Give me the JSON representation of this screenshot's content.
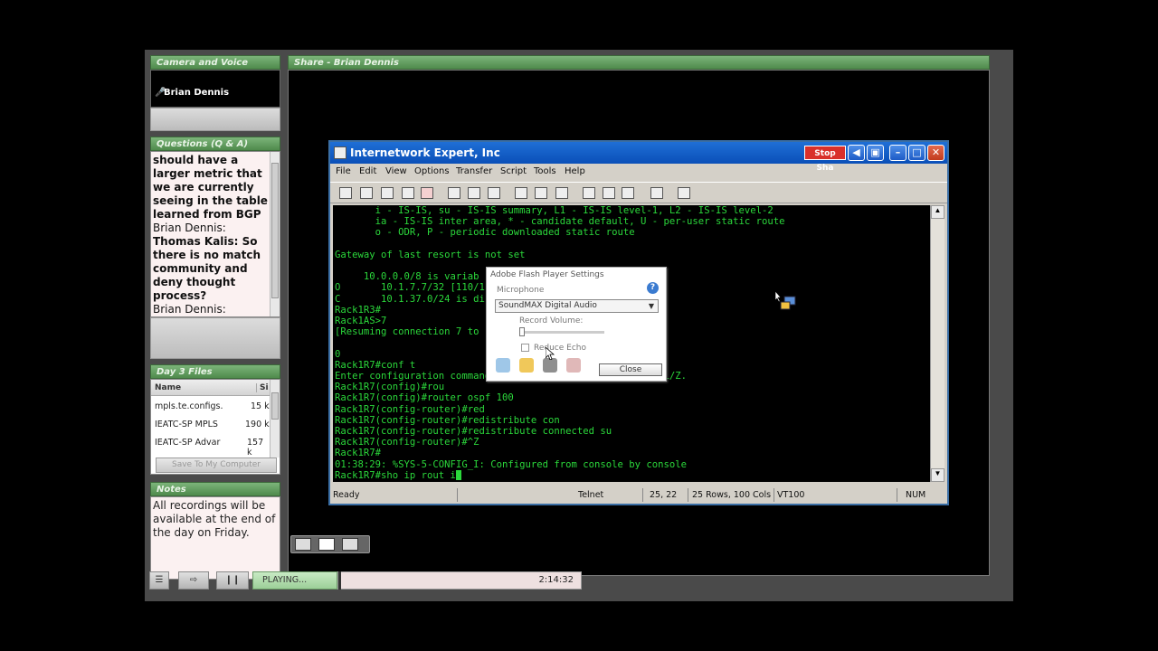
{
  "panels": {
    "camera": {
      "title": "Camera and Voice",
      "presenter": "Brian Dennis"
    },
    "qa": {
      "title": "Questions (Q & A)",
      "lines": [
        {
          "text": "should have a",
          "bold": true
        },
        {
          "text": "larger metric that",
          "bold": true
        },
        {
          "text": "we are currently",
          "bold": true
        },
        {
          "text": "seeing in the table",
          "bold": true
        },
        {
          "text": "learned from BGP",
          "bold": true
        },
        {
          "text": "Brian Dennis:",
          "bold": false
        },
        {
          "text": "Thomas Kalis: So",
          "bold": true
        },
        {
          "text": "there is no match",
          "bold": true
        },
        {
          "text": "community and",
          "bold": true
        },
        {
          "text": "deny thought",
          "bold": true
        },
        {
          "text": "process?",
          "bold": true
        },
        {
          "text": "Brian Dennis:",
          "bold": false
        }
      ]
    },
    "files": {
      "title": "Day 3 Files",
      "col_name": "Name",
      "col_size": "Si",
      "rows": [
        {
          "name": "mpls.te.configs.",
          "size": "15 k"
        },
        {
          "name": "IEATC-SP MPLS",
          "size": "190 k"
        },
        {
          "name": "IEATC-SP Advar",
          "size": "157 k"
        }
      ],
      "save_label": "Save To My Computer"
    },
    "notes": {
      "title": "Notes",
      "text": "All recordings will be available at the end of the day on Friday."
    },
    "share": {
      "title": "Share - Brian Dennis"
    }
  },
  "window": {
    "title": "Internetwork Expert, Inc",
    "stop_share": "Stop Sha",
    "menu": [
      "File",
      "Edit",
      "View",
      "Options",
      "Transfer",
      "Script",
      "Tools",
      "Help"
    ],
    "terminal_lines": [
      "       i - IS-IS, su - IS-IS summary, L1 - IS-IS level-1, L2 - IS-IS level-2",
      "       ia - IS-IS inter area, * - candidate default, U - per-user static route",
      "       o - ODR, P - periodic downloaded static route",
      "",
      "Gateway of last resort is not set",
      "",
      "     10.0.0.0/8 is variab                        s",
      "O       10.1.7.7/32 [110/1                     hernet0/0",
      "C       10.1.37.0/24 is di",
      "Rack1R3#",
      "Rack1AS>7",
      "[Resuming connection 7 to",
      "",
      "0",
      "Rack1R7#conf t",
      "Enter configuration commands, one per line.  End with CNTL/Z.",
      "Rack1R7(config)#rou",
      "Rack1R7(config)#router ospf 100",
      "Rack1R7(config-router)#red",
      "Rack1R7(config-router)#redistribute con",
      "Rack1R7(config-router)#redistribute connected su",
      "Rack1R7(config-router)#^Z",
      "Rack1R7#",
      "01:38:29: %SYS-5-CONFIG_I: Configured from console by console",
      "Rack1R7#sho ip rout i"
    ],
    "status": {
      "ready": "Ready",
      "protocol": "Telnet",
      "position": "25,  22",
      "size": "25 Rows, 100 Cols",
      "emulation": "VT100",
      "num": "NUM"
    }
  },
  "flash_dialog": {
    "title": "Adobe Flash Player Settings",
    "section": "Microphone",
    "device": "SoundMAX Digital Audio",
    "record_volume": "Record Volume:",
    "reduce_echo": "Reduce Echo",
    "close": "Close"
  },
  "player": {
    "status": "PLAYING...",
    "time": "2:14:32",
    "pause_icon": "pause-icon"
  },
  "colors": {
    "terminal_text": "#2bd83b",
    "header_green": "#5e9b5b",
    "titlebar_blue": "#1f6fd6"
  }
}
